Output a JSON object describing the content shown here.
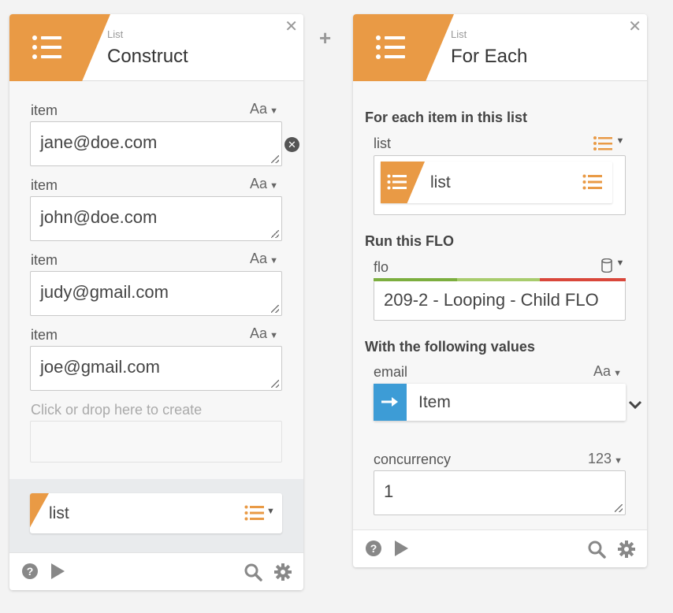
{
  "left_card": {
    "category": "List",
    "title": "Construct",
    "items": [
      {
        "label": "item",
        "type": "Aa",
        "value": "jane@doe.com"
      },
      {
        "label": "item",
        "type": "Aa",
        "value": "john@doe.com"
      },
      {
        "label": "item",
        "type": "Aa",
        "value": "judy@gmail.com"
      },
      {
        "label": "item",
        "type": "Aa",
        "value": "joe@gmail.com"
      }
    ],
    "create_hint": "Click or drop here to create",
    "output_label": "list"
  },
  "right_card": {
    "category": "List",
    "title": "For Each",
    "section_list": "For each item in this list",
    "list_field_label": "list",
    "list_token_label": "list",
    "section_run": "Run this FLO",
    "flo_label": "flo",
    "flo_value": "209-2 - Looping - Child FLO",
    "section_values": "With the following values",
    "email_label": "email",
    "email_type": "Aa",
    "email_token_label": "Item",
    "concurrency_label": "concurrency",
    "concurrency_type": "123",
    "concurrency_value": "1"
  },
  "colors": {
    "accent_orange": "#e99a45",
    "token_blue": "#3d9cd6",
    "status_green": "#7cae3f",
    "status_red": "#d9473b"
  }
}
